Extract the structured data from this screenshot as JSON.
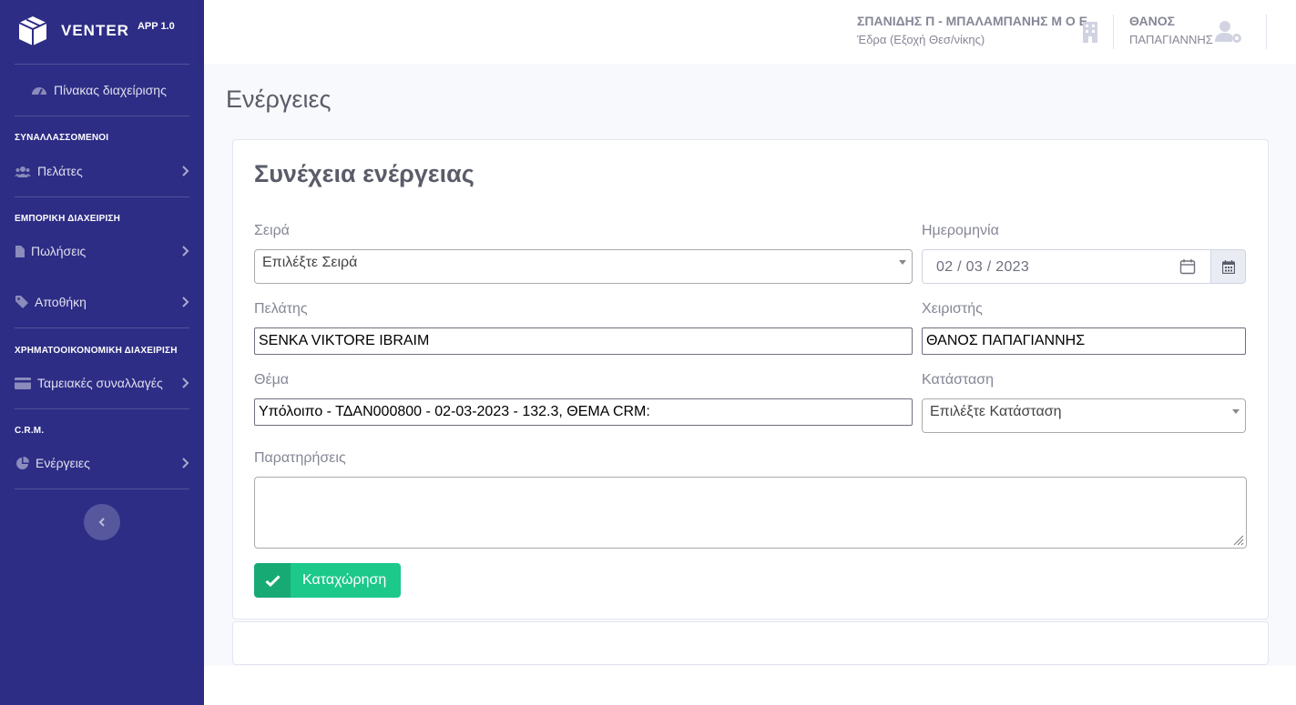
{
  "brand": {
    "name": "VENTER",
    "version": "APP 1.0"
  },
  "sidebar": {
    "dashboard": "Πίνακας διαχείρισης",
    "sections": [
      {
        "heading": "ΣΥΝΑΛΛΑΣΣΟΜΕΝΟΙ",
        "items": [
          {
            "label": "Πελάτες",
            "icon": "users-icon"
          }
        ]
      },
      {
        "heading": "ΕΜΠΟΡΙΚΗ ΔΙΑΧΕΙΡΙΣΗ",
        "items": [
          {
            "label": "Πωλήσεις",
            "icon": "file-icon"
          },
          {
            "label": "Αποθήκη",
            "icon": "tag-icon"
          }
        ]
      },
      {
        "heading": "ΧΡΗΜΑΤΟΟΙΚΟΝΟΜΙΚΗ ΔΙΑΧΕΙΡΙΣΗ",
        "items": [
          {
            "label": "Ταμειακές συναλλαγές",
            "icon": "credit-card-icon"
          }
        ]
      },
      {
        "heading": "C.R.M.",
        "items": [
          {
            "label": "Ενέργειες",
            "icon": "pie-chart-icon"
          }
        ]
      }
    ]
  },
  "topbar": {
    "company_name": "ΣΠΑΝΙΔΗΣ Π - ΜΠΑΛΑΜΠΑΝΗΣ Μ Ο Ε",
    "company_branch": "Έδρα (Εξοχή Θεσ/νίκης)",
    "user_first": "ΘΑΝΟΣ",
    "user_last": "ΠΑΠΑΓΙΑΝΝΗΣ"
  },
  "page": {
    "title": "Ενέργειες",
    "card_title": "Συνέχεια ενέργειας"
  },
  "form": {
    "series_label": "Σειρά",
    "series_value": "Επιλέξτε Σειρά",
    "date_label": "Ημερομηνία",
    "date_value": "02 / 03 / 2023",
    "customer_label": "Πελάτης",
    "customer_value": "SENKA  VIKTORE IBRAIM",
    "handler_label": "Χειριστής",
    "handler_value": "ΘΑΝΟΣ ΠΑΠΑΓΙΑΝΝΗΣ",
    "subject_label": "Θέμα",
    "subject_value": "Υπόλοιπο - ΤΔΑΝ000800 - 02-03-2023 - 132.3, ΘΕΜΑ CRM:",
    "status_label": "Κατάσταση",
    "status_value": "Επιλέξτε Κατάσταση",
    "notes_label": "Παρατηρήσεις",
    "notes_value": "",
    "submit_label": "Καταχώρηση"
  },
  "colors": {
    "sidebar_bg": "#2d2d86",
    "success": "#1cc88a",
    "text_muted": "#858796"
  }
}
